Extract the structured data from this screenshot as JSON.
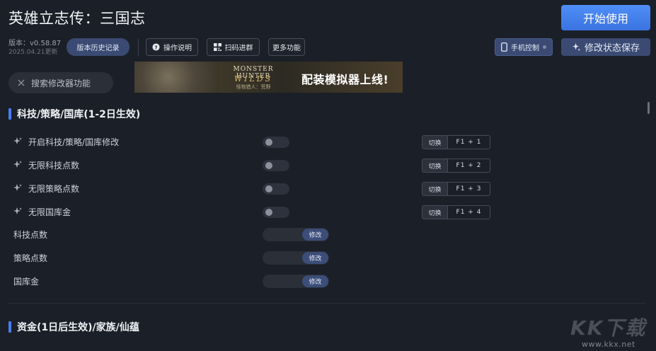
{
  "header": {
    "title": "英雄立志传：三国志",
    "start_label": "开始使用",
    "version_label": "版本：v0.58.87",
    "version_date": "2025.04.21更新",
    "history_label": "版本历史记录",
    "manual_label": "操作说明",
    "qr_label": "扫码进群",
    "more_label": "更多功能",
    "phone_label": "手机控制",
    "save_label": "修改状态保存"
  },
  "search": {
    "placeholder": "搜索修改器功能"
  },
  "banner": {
    "game_line1": "MONSTER HUNTER",
    "game_line2": "WILDS",
    "game_line3": "怪物猎人：荒野",
    "promo": "配装模拟器上线!"
  },
  "sections": [
    {
      "title": "科技/策略/国库(1-2日生效)",
      "toggles": [
        {
          "label": "开启科技/策略/国库修改",
          "switch_label": "切换",
          "hotkey": "F1 + 1"
        },
        {
          "label": "无限科技点数",
          "switch_label": "切换",
          "hotkey": "F1 + 2"
        },
        {
          "label": "无限策略点数",
          "switch_label": "切换",
          "hotkey": "F1 + 3"
        },
        {
          "label": "无限国库金",
          "switch_label": "切换",
          "hotkey": "F1 + 4"
        }
      ],
      "inputs": [
        {
          "label": "科技点数",
          "button": "修改"
        },
        {
          "label": "策略点数",
          "button": "修改"
        },
        {
          "label": "国库金",
          "button": "修改"
        }
      ]
    },
    {
      "title": "资金(1日后生效)/家族/仙蕴"
    }
  ],
  "watermark": {
    "logo": "KK下载",
    "url": "www.kkx.net"
  }
}
